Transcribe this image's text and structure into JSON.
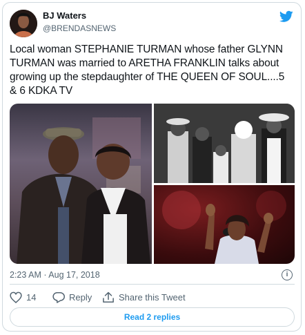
{
  "author": {
    "name": "BJ Waters",
    "handle": "@BRENDASNEWS"
  },
  "tweet": {
    "text": "Local woman STEPHANIE TURMAN whose father GLYNN TURMAN was married to ARETHA FRANKLIN talks about growing up the stepdaughter of THE QUEEN OF SOUL....5 & 6 KDKA TV"
  },
  "meta": {
    "timestamp": "2:23 AM · Aug 17, 2018"
  },
  "actions": {
    "like_count": "14",
    "reply_label": "Reply",
    "share_label": "Share this Tweet"
  },
  "replies_button": "Read 2 replies",
  "colors": {
    "accent": "#1d9bf0",
    "secondary_text": "#536471",
    "border": "#cfd9de",
    "primary_text": "#0f1419"
  },
  "icons": [
    "twitter-bird-icon",
    "info-icon",
    "heart-icon",
    "reply-bubble-icon",
    "share-icon"
  ]
}
